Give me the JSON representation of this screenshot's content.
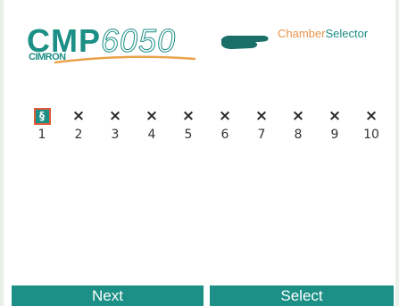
{
  "header": {
    "logo_prefix": "CMP",
    "logo_number": "6050",
    "brand": "CIMRON",
    "title_part1": "Chamber",
    "title_part2": "Selector",
    "hand_icon": "pointing-hand-icon",
    "colors": {
      "teal": "#1c8f86",
      "orange": "#e8934a",
      "highlight": "#e05a3a"
    }
  },
  "chambers": [
    {
      "number": "1",
      "mark": "§",
      "selected": true
    },
    {
      "number": "2",
      "mark": "×"
    },
    {
      "number": "3",
      "mark": "×"
    },
    {
      "number": "4",
      "mark": "×"
    },
    {
      "number": "5",
      "mark": "×"
    },
    {
      "number": "6",
      "mark": "×"
    },
    {
      "number": "7",
      "mark": "×"
    },
    {
      "number": "8",
      "mark": "×"
    },
    {
      "number": "9",
      "mark": "×"
    },
    {
      "number": "10",
      "mark": "×"
    }
  ],
  "softkeys": {
    "left": "Next",
    "right": "Select"
  }
}
